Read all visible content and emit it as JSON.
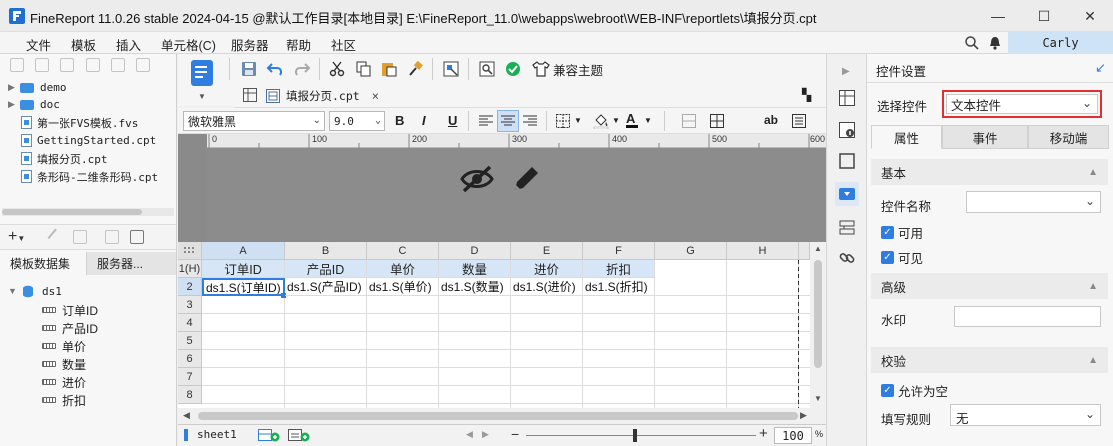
{
  "window": {
    "title": "FineReport 11.0.26 stable 2024-04-15 @默认工作目录[本地目录]   E:\\FineReport_11.0\\webapps\\webroot\\WEB-INF\\reportlets\\填报分页.cpt",
    "minimize": "—",
    "maximize": "☐",
    "close": "✕"
  },
  "menu": {
    "items": [
      "文件",
      "模板",
      "插入",
      "单元格(C)",
      "服务器",
      "帮助",
      "社区"
    ],
    "user": "Carly"
  },
  "file_tree": [
    {
      "type": "folder",
      "label": "demo"
    },
    {
      "type": "folder",
      "label": "doc"
    },
    {
      "type": "file",
      "label": "第一张FVS模板.fvs"
    },
    {
      "type": "file",
      "label": "GettingStarted.cpt"
    },
    {
      "type": "file",
      "label": "填报分页.cpt"
    },
    {
      "type": "file",
      "label": "条形码-二维条形码.cpt"
    }
  ],
  "left_tabs": {
    "dataset": "模板数据集",
    "server": "服务器..."
  },
  "dataset": {
    "name": "ds1",
    "fields": [
      "订单ID",
      "产品ID",
      "单价",
      "数量",
      "进价",
      "折扣"
    ]
  },
  "toolbar": {
    "theme_label": "兼容主题"
  },
  "doc_tab": {
    "label": "填报分页.cpt"
  },
  "format": {
    "font": "微软雅黑",
    "size": "9.0",
    "bold": "B",
    "italic": "I",
    "underline": "U",
    "ab": "ab"
  },
  "ruler": {
    "ticks": [
      "0",
      "100",
      "200",
      "300",
      "400",
      "500",
      "600"
    ]
  },
  "sheet": {
    "columns": [
      "A",
      "B",
      "C",
      "D",
      "E",
      "F",
      "G",
      "H"
    ],
    "rows": [
      "1(H)",
      "2",
      "3",
      "4",
      "5",
      "6",
      "7",
      "8"
    ],
    "header_row": [
      "订单ID",
      "产品ID",
      "单价",
      "数量",
      "进价",
      "折扣"
    ],
    "data_row": [
      "ds1.S(订单ID)",
      "ds1.S(产品ID)",
      "ds1.S(单价)",
      "ds1.S(数量)",
      "ds1.S(进价)",
      "ds1.S(折扣)"
    ]
  },
  "bottom": {
    "sheet_name": "sheet1",
    "zoom": "100",
    "zoom_unit": "%",
    "minus": "−",
    "plus": "+"
  },
  "right_panel": {
    "title": "控件设置",
    "select_label": "选择控件",
    "select_value": "文本控件",
    "tabs": [
      "属性",
      "事件",
      "移动端"
    ],
    "section_basic": "基本",
    "widget_name_label": "控件名称",
    "widget_name_value": "",
    "enabled_label": "可用",
    "visible_label": "可见",
    "section_advanced": "高级",
    "watermark_label": "水印",
    "watermark_value": "",
    "section_validate": "校验",
    "allow_empty_label": "允许为空",
    "rule_label": "填写规则",
    "rule_value": "无"
  },
  "colors": {
    "accent": "#2f7de1",
    "highlight_border": "#e03030",
    "header_fill": "#d6e6f6",
    "user_box": "#cfe3f7"
  }
}
